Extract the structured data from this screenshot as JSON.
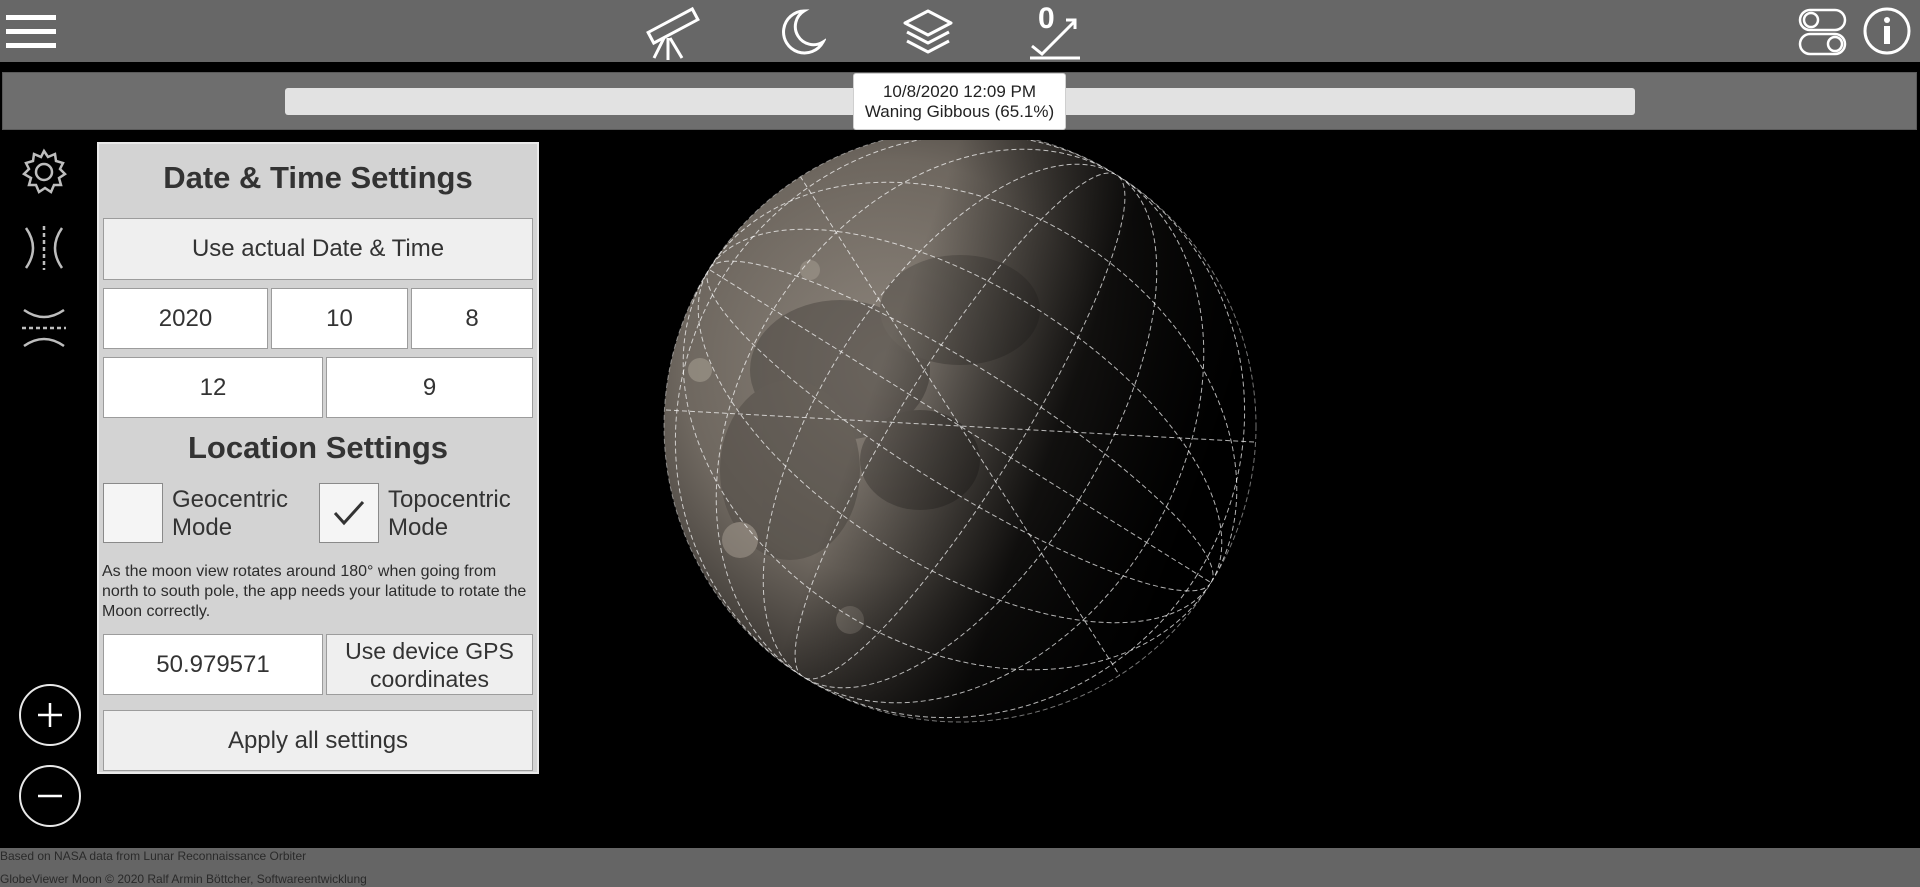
{
  "toolbar": {
    "menu_icon": "hamburger-menu-icon",
    "telescope_icon": "telescope-icon",
    "moon_icon": "crescent-moon-icon",
    "layers_icon": "layers-icon",
    "zero_icon": "zero-check-icon",
    "zero_label": "0",
    "toggles_icon": "toggles-icon",
    "info_icon": "info-icon"
  },
  "timeline": {
    "date_time": "10/8/2020 12:09 PM",
    "phase": "Waning Gibbous (65.1%)"
  },
  "side_tools": [
    "settings-gear-icon",
    "horizontal-flip-icon",
    "vertical-flip-icon"
  ],
  "zoom": {
    "in": "+",
    "out": "−"
  },
  "settings": {
    "date_time_title": "Date & Time Settings",
    "use_actual_label": "Use actual Date & Time",
    "year": "2020",
    "month": "10",
    "day": "8",
    "hour": "12",
    "minute": "9",
    "location_title": "Location Settings",
    "geocentric_label": "Geocentric Mode",
    "geocentric_checked": false,
    "topocentric_label": "Topocentric Mode",
    "topocentric_checked": true,
    "info": "As the moon view rotates around 180° when going from north to south pole, the app needs your latitude to rotate the Moon correctly.",
    "latitude": "50.979571",
    "gps_label": "Use device GPS coordinates",
    "apply_label": "Apply all settings"
  },
  "footer": {
    "line1": "Based on NASA data from Lunar Reconnaissance Orbiter",
    "line2": "GlobeViewer Moon © 2020 Ralf Armin Böttcher, Softwareentwicklung"
  },
  "colors": {
    "toolbar_bg": "#676767",
    "panel_bg": "#d3d3d3",
    "viewport_bg": "#000000"
  }
}
